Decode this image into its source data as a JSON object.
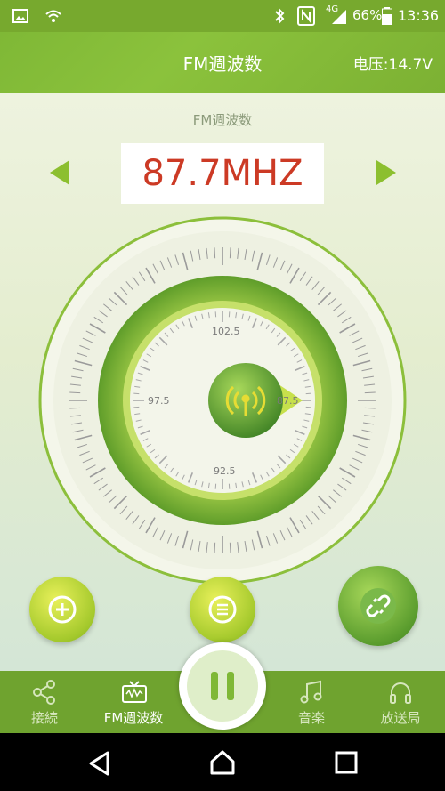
{
  "status_bar": {
    "network": "4G",
    "battery": "66%",
    "time": "13:36"
  },
  "header": {
    "title": "FM週波数",
    "voltage": "电压:14.7V"
  },
  "tuner": {
    "label": "FM週波数",
    "frequency": "87.7MHZ",
    "scale": {
      "top": "102.5",
      "left": "97.5",
      "right": "87.5",
      "bottom": "92.5"
    }
  },
  "bottom_nav": {
    "items": [
      {
        "label": "接続",
        "icon": "share-icon"
      },
      {
        "label": "FM週波数",
        "icon": "tv-icon",
        "active": true
      },
      {
        "label": "音楽",
        "icon": "music-icon"
      },
      {
        "label": "放送局",
        "icon": "headphones-icon"
      }
    ]
  },
  "colors": {
    "accent": "#7fb836",
    "frequency_text": "#cc3a25"
  }
}
